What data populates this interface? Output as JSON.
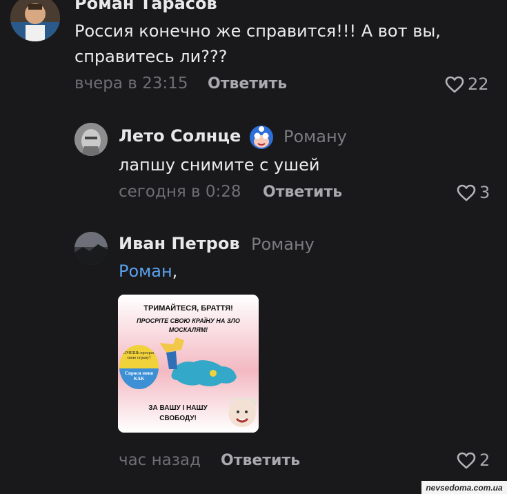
{
  "comments": [
    {
      "author": "Роман Тарасов",
      "reply_to": "",
      "mention": "",
      "text_lines": [
        "Россия конечно же справится!!! А вот вы,",
        "справитесь ли???"
      ],
      "time": "вчера в 23:15",
      "reply_label": "Ответить",
      "likes": "22"
    },
    {
      "author": "Лето Солнце",
      "reply_to": "Роману",
      "text_lines": [
        "лапшу снимите с ушей"
      ],
      "time": "сегодня в 0:28",
      "reply_label": "Ответить",
      "likes": "3"
    },
    {
      "author": "Иван Петров",
      "reply_to": "Роману",
      "mention": "Роман",
      "text_suffix": ",",
      "time": "час назад",
      "reply_label": "Ответить",
      "likes": "2",
      "attachment": {
        "title": "ТРИМАЙТЕСЯ, БРАТТЯ!",
        "subtitle": "ПРОСРІТЕ СВОЮ КРАЇНУ НА ЗЛО МОСКАЛЯМ!",
        "badge_top": "ХОЧЕШЬ просрать свою страну?",
        "badge_bottom": "Спроси меня КАК",
        "bottom": "ЗА ВАШУ І НАШУ СВОБОДУ!"
      }
    }
  ],
  "watermark": "nevsedoma.com.ua",
  "colors": {
    "background": "#19191b",
    "mention": "#5aa2ee",
    "muted": "#6f6f74"
  },
  "icons": {
    "like": "heart-outline-icon",
    "emoji": "mask-face-emoji-icon"
  }
}
